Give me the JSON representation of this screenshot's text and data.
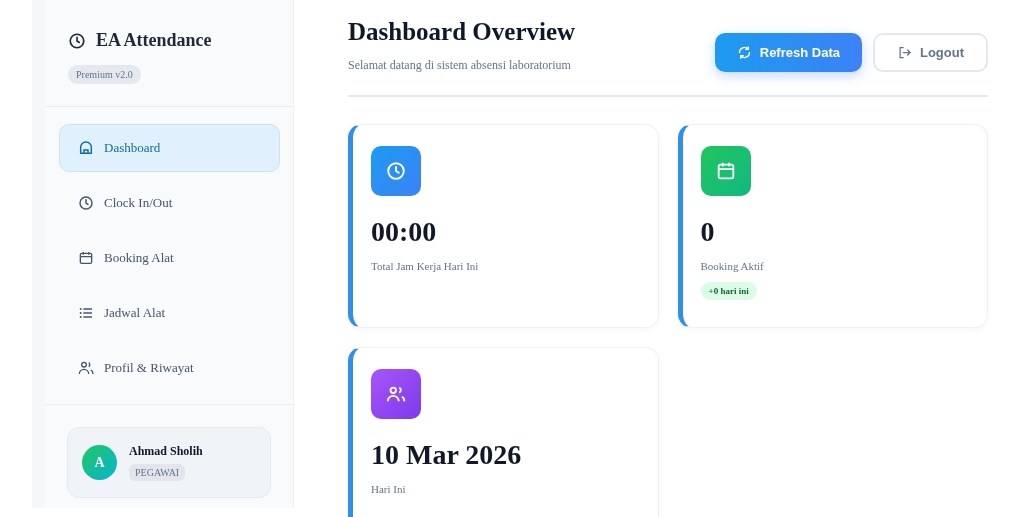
{
  "sidebar": {
    "brand": "EA Attendance",
    "version": "Premium v2.0",
    "items": [
      {
        "label": "Dashboard",
        "kind": "home",
        "selected": true
      },
      {
        "label": "Clock In/Out",
        "kind": "clock",
        "selected": false
      },
      {
        "label": "Booking Alat",
        "kind": "calendar",
        "selected": false
      },
      {
        "label": "Jadwal Alat",
        "kind": "list",
        "selected": false
      },
      {
        "label": "Profil & Riwayat",
        "kind": "users",
        "selected": false
      }
    ],
    "user": {
      "initial": "A",
      "name": "Ahmad Sholih",
      "role": "PEGAWAI"
    }
  },
  "header": {
    "title": "Dashboard Overview",
    "subtitle": "Selamat datang di sistem absensi laboratorium",
    "buttons": [
      {
        "label": "Refresh Data",
        "kind": "primary"
      },
      {
        "label": "Logout",
        "kind": "outline"
      }
    ]
  },
  "cards": [
    {
      "kind": "clock",
      "value": "00:00",
      "label": "Total Jam Kerja Hari Ini"
    },
    {
      "kind": "calendar",
      "value": "0",
      "label": "Booking Aktif",
      "badge": "+0 hari ini"
    },
    {
      "kind": "users",
      "value": "10 Mar 2026",
      "label": "Hari Ini"
    }
  ]
}
